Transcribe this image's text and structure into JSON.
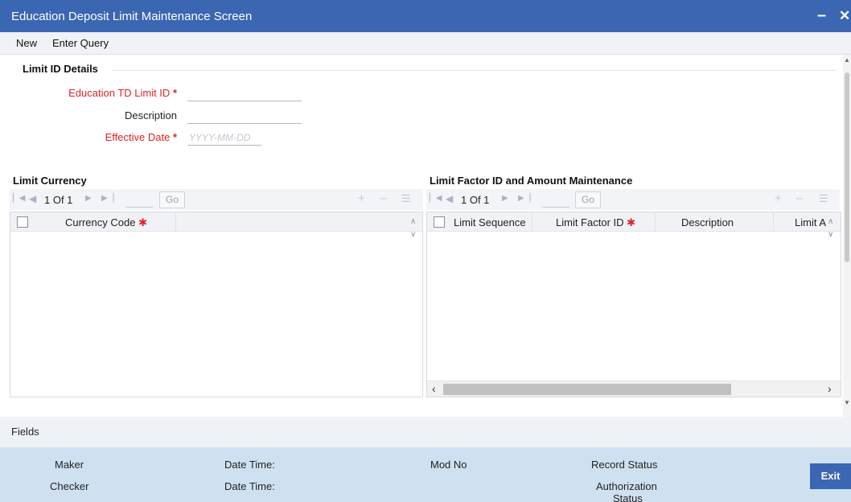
{
  "window": {
    "title": "Education Deposit Limit Maintenance Screen",
    "minimize_glyph": "–",
    "close_glyph": "✕"
  },
  "menu": {
    "new_label": "New",
    "enter_query_label": "Enter Query"
  },
  "limit_id_details": {
    "section_title": "Limit ID Details",
    "limit_id_label": "Education TD Limit ID",
    "limit_id_value": "",
    "description_label": "Description",
    "description_value": "",
    "effective_date_label": "Effective Date",
    "effective_date_placeholder": "YYYY-MM-DD",
    "required_marker": "*"
  },
  "limit_currency": {
    "section_title": "Limit Currency",
    "pager_text": "1 Of 1",
    "go_label": "Go",
    "columns": [
      "Currency Code"
    ],
    "rows": []
  },
  "limit_factor": {
    "section_title": "Limit Factor ID and Amount Maintenance",
    "pager_text": "1 Of 1",
    "go_label": "Go",
    "columns": [
      "Limit Sequence",
      "Limit Factor ID",
      "Description",
      "Limit A"
    ],
    "rows": []
  },
  "fields_bar": {
    "label": "Fields"
  },
  "audit": {
    "maker_label": "Maker",
    "checker_label": "Checker",
    "date_time_label": "Date Time:",
    "mod_no_label": "Mod No",
    "record_status_label": "Record Status",
    "authorization_status_label_1": "Authorization",
    "authorization_status_label_2": "Status",
    "exit_label": "Exit"
  },
  "colors": {
    "title_bar": "#3a66b2",
    "required_text": "#e0232a",
    "footer_bg": "#cfe1f1"
  }
}
